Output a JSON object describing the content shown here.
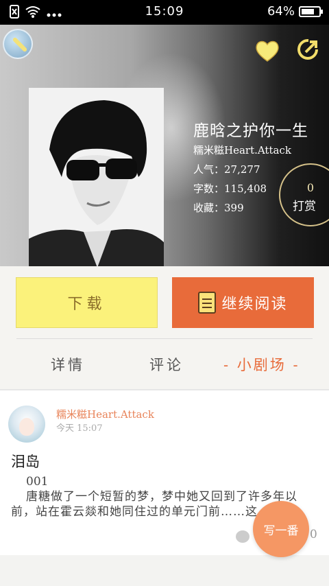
{
  "status_bar": {
    "time": "15:09",
    "battery": "64%",
    "battery_level": 0.64
  },
  "book": {
    "title": "鹿晗之护你一生",
    "author": "糯米糍Heart.Attack",
    "popularity": "人气：27,277",
    "word_count": "字数：115,408",
    "favorites": "收藏：399",
    "reward_count": "0",
    "reward_label": "打赏"
  },
  "actions": {
    "download_label": "下载",
    "read_label": "继续阅读"
  },
  "tabs": [
    {
      "label": "详情"
    },
    {
      "label": "评论"
    },
    {
      "label": "- 小剧场 -"
    }
  ],
  "post": {
    "author": "糯米糍Heart.Attack",
    "time": "今天 15:07",
    "title": "泪岛",
    "number": "001",
    "body": "唐糖做了一个短暂的梦，梦中她又回到了许多年以前，站在霍云燚和她同住过的单元门前……这",
    "comment_count": "0"
  },
  "fab": {
    "label": "写一番"
  },
  "colors": {
    "accent": "#e86b3a",
    "download": "#fbf27b",
    "fab": "#f59764"
  }
}
